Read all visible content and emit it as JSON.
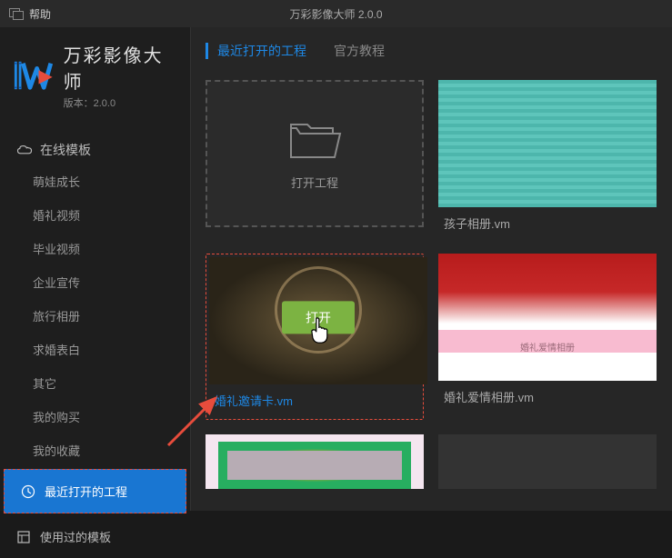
{
  "titlebar": {
    "help": "帮助",
    "title": "万彩影像大师 2.0.0"
  },
  "logo": {
    "title": "万彩影像大师",
    "version": "版本：2.0.0"
  },
  "sidebar": {
    "online_templates_header": "在线模板",
    "categories": [
      "萌娃成长",
      "婚礼视频",
      "毕业视频",
      "企业宣传",
      "旅行相册",
      "求婚表白",
      "其它"
    ],
    "my_purchases": "我的购买",
    "my_favorites": "我的收藏",
    "recent_projects": "最近打开的工程",
    "used_templates": "使用过的模板"
  },
  "tabs": {
    "recent": "最近打开的工程",
    "official": "官方教程"
  },
  "grid": {
    "open_project": "打开工程",
    "open_btn": "打开",
    "items": [
      {
        "label": "孩子相册.vm"
      },
      {
        "label": "婚礼邀请卡.vm"
      },
      {
        "label": "婚礼爱情相册.vm",
        "inner": "婚礼爱情相册"
      }
    ]
  }
}
